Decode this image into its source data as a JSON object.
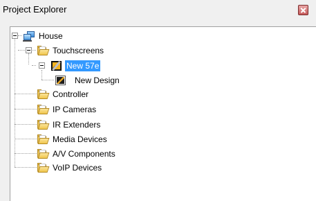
{
  "panel": {
    "title": "Project Explorer",
    "close_icon": "close-icon"
  },
  "tree": {
    "root": {
      "label": "House",
      "icon": "house-network-icon",
      "expanded": true,
      "children": [
        {
          "label": "Touchscreens",
          "icon": "folder-open-icon",
          "expanded": true,
          "children": [
            {
              "label": "New 57e",
              "icon": "touchscreen-device-icon",
              "selected": true,
              "expanded": true,
              "children": [
                {
                  "label": "New Design",
                  "icon": "design-icon"
                }
              ]
            }
          ]
        },
        {
          "label": "Controller",
          "icon": "folder-open-icon"
        },
        {
          "label": "IP Cameras",
          "icon": "folder-open-icon"
        },
        {
          "label": "IR Extenders",
          "icon": "folder-open-icon"
        },
        {
          "label": "Media Devices",
          "icon": "folder-open-icon"
        },
        {
          "label": "A/V Components",
          "icon": "folder-open-icon"
        },
        {
          "label": "VoIP Devices",
          "icon": "folder-open-icon"
        }
      ]
    }
  },
  "colors": {
    "selection": "#3399ff",
    "panel_bg": "#f0f0f0",
    "tree_bg": "#ffffff"
  }
}
